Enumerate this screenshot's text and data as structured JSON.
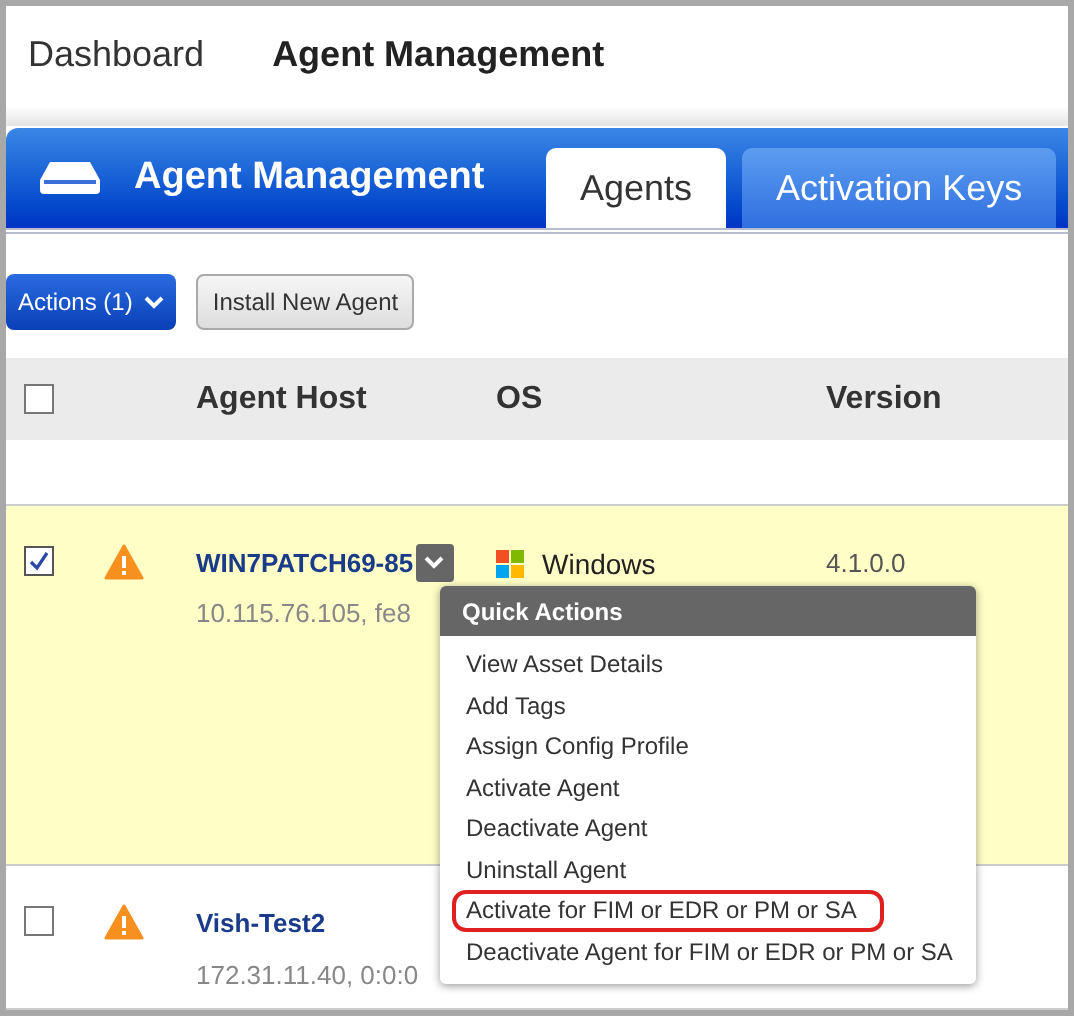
{
  "breadcrumb": [
    {
      "label": "Dashboard",
      "selected": false
    },
    {
      "label": "Agent Management",
      "selected": true
    }
  ],
  "header": {
    "title": "Agent Management"
  },
  "tabs": [
    {
      "label": "Agents",
      "selected": true
    },
    {
      "label": "Activation Keys",
      "selected": false
    }
  ],
  "toolbar": {
    "actions_button": "Actions (1)",
    "install_button": "Install New Agent"
  },
  "table": {
    "select_all": {
      "checked": false
    },
    "columns": [
      "Agent Host",
      "OS",
      "Version"
    ],
    "rows": [
      {
        "checked": true,
        "host": "WIN7PATCH69-85",
        "address": "10.115.76.105, fe8",
        "os": "Windows",
        "version": "4.1.0.0",
        "menu_open": true
      },
      {
        "checked": false,
        "host": "Vish-Test2",
        "address": "172.31.11.40, 0:0:0",
        "menu_open": false
      }
    ]
  },
  "quick_actions": {
    "title": "Quick Actions",
    "items": [
      {
        "label": "View Asset Details",
        "highlighted": false
      },
      {
        "label": "Add Tags",
        "highlighted": false
      },
      {
        "label": "Assign Config Profile",
        "highlighted": false
      },
      {
        "label": "Activate Agent",
        "highlighted": false
      },
      {
        "label": "Deactivate Agent",
        "highlighted": false
      },
      {
        "label": "Uninstall Agent",
        "highlighted": false
      },
      {
        "label": "Activate for FIM or EDR or PM or SA",
        "highlighted": true
      },
      {
        "label": "Deactivate Agent for FIM or EDR or PM or SA",
        "highlighted": false
      }
    ]
  }
}
